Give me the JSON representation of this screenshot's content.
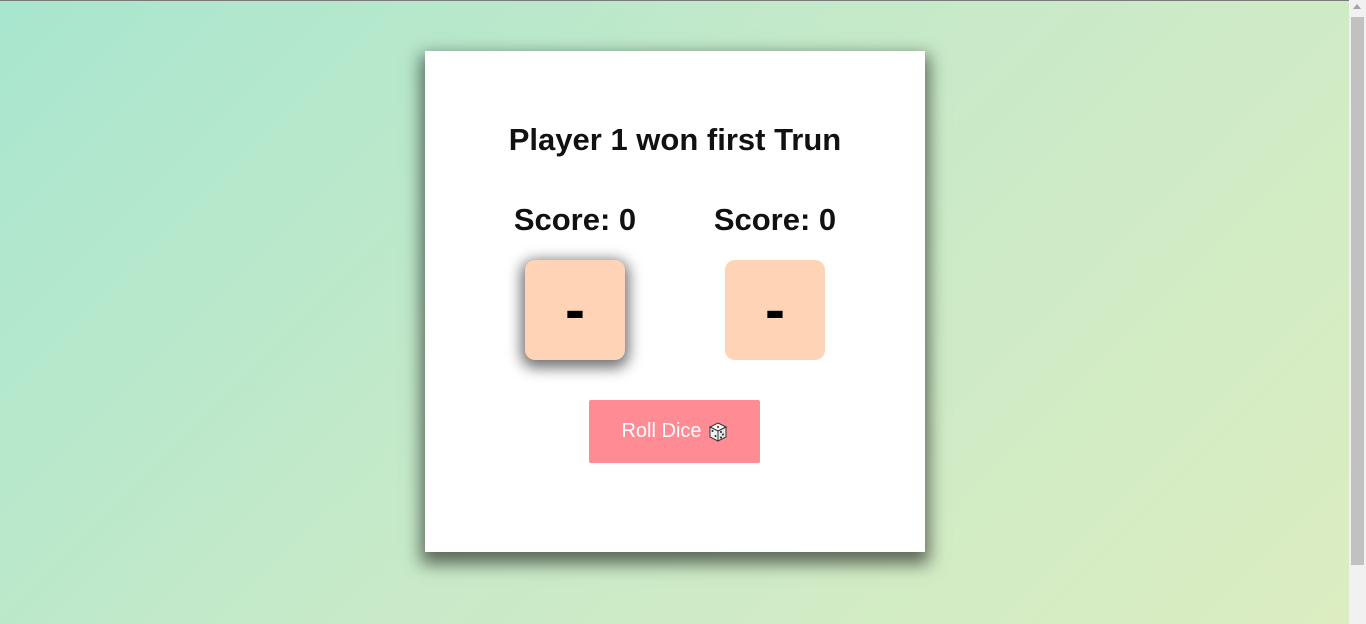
{
  "game": {
    "title": "Player 1 won first Trun",
    "players": [
      {
        "score_label": "Score: ",
        "score": "0",
        "die_face": "-",
        "active": true
      },
      {
        "score_label": "Score: ",
        "score": "0",
        "die_face": "-",
        "active": false
      }
    ],
    "roll_button": {
      "label": "Roll Dice",
      "icon": "dice-icon"
    }
  },
  "colors": {
    "background_start": "#a8e6cf",
    "background_end": "#dcedc1",
    "card": "#ffffff",
    "die": "#ffd3b6",
    "button": "#ff8b94",
    "button_text": "#ffffff"
  }
}
